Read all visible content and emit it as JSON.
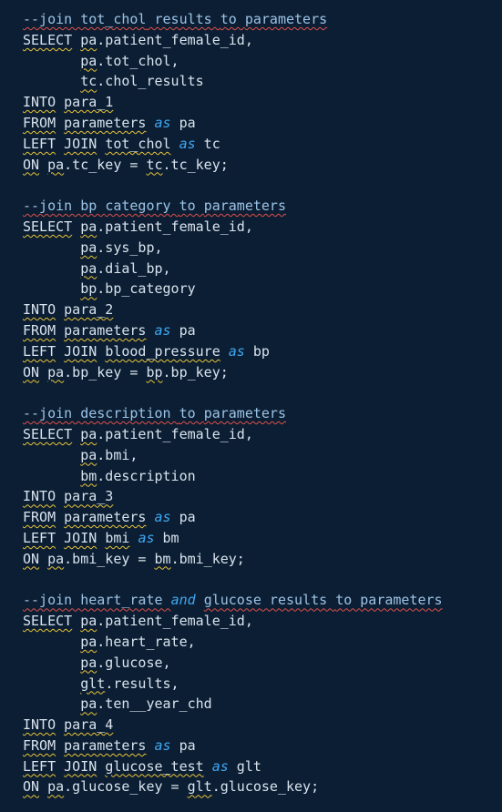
{
  "editor": {
    "lines": [
      [
        {
          "t": "--join ",
          "c": "comment sqr"
        },
        {
          "t": "tot_chol",
          "c": "comment sqr"
        },
        {
          "t": " results ",
          "c": "comment sqr"
        },
        {
          "t": "to ",
          "c": "comment sqr"
        },
        {
          "t": "parameters",
          "c": "comment sqr"
        }
      ],
      [
        {
          "t": "SELECT",
          "c": "kw sq"
        },
        {
          "t": " ",
          "c": "plain"
        },
        {
          "t": "pa",
          "c": "plain sq"
        },
        {
          "t": ".patient_female_id,",
          "c": "plain"
        }
      ],
      [
        {
          "t": "       ",
          "c": "plain"
        },
        {
          "t": "pa",
          "c": "plain sq"
        },
        {
          "t": ".tot_chol,",
          "c": "plain"
        }
      ],
      [
        {
          "t": "       ",
          "c": "plain"
        },
        {
          "t": "tc",
          "c": "plain sq"
        },
        {
          "t": ".chol_results",
          "c": "plain"
        }
      ],
      [
        {
          "t": "INTO",
          "c": "kw sq"
        },
        {
          "t": " ",
          "c": "plain"
        },
        {
          "t": "para_1",
          "c": "plain sq"
        }
      ],
      [
        {
          "t": "FROM",
          "c": "kw sq"
        },
        {
          "t": " ",
          "c": "plain"
        },
        {
          "t": "parameters",
          "c": "plain sq"
        },
        {
          "t": " ",
          "c": "plain"
        },
        {
          "t": "as",
          "c": "it"
        },
        {
          "t": " pa",
          "c": "plain"
        }
      ],
      [
        {
          "t": "LEFT",
          "c": "kw sq"
        },
        {
          "t": " ",
          "c": "plain"
        },
        {
          "t": "JOIN",
          "c": "kw sq"
        },
        {
          "t": " ",
          "c": "plain"
        },
        {
          "t": "tot_chol",
          "c": "plain sq"
        },
        {
          "t": " ",
          "c": "plain"
        },
        {
          "t": "as",
          "c": "it"
        },
        {
          "t": " tc",
          "c": "plain"
        }
      ],
      [
        {
          "t": "ON",
          "c": "kw sq"
        },
        {
          "t": " ",
          "c": "plain"
        },
        {
          "t": "pa",
          "c": "plain sq"
        },
        {
          "t": ".tc_key = ",
          "c": "plain"
        },
        {
          "t": "tc",
          "c": "plain sq"
        },
        {
          "t": ".tc_key;",
          "c": "plain"
        }
      ],
      [],
      [
        {
          "t": "--join ",
          "c": "comment sqr"
        },
        {
          "t": "bp ",
          "c": "comment sqr"
        },
        {
          "t": "category ",
          "c": "comment sqr"
        },
        {
          "t": "to ",
          "c": "comment sqr"
        },
        {
          "t": "parameters",
          "c": "comment sqr"
        }
      ],
      [
        {
          "t": "SELECT",
          "c": "kw sq"
        },
        {
          "t": " ",
          "c": "plain"
        },
        {
          "t": "pa",
          "c": "plain sq"
        },
        {
          "t": ".patient_female_id,",
          "c": "plain"
        }
      ],
      [
        {
          "t": "       ",
          "c": "plain"
        },
        {
          "t": "pa",
          "c": "plain sq"
        },
        {
          "t": ".sys_bp,",
          "c": "plain"
        }
      ],
      [
        {
          "t": "       ",
          "c": "plain"
        },
        {
          "t": "pa",
          "c": "plain sq"
        },
        {
          "t": ".dial_bp,",
          "c": "plain"
        }
      ],
      [
        {
          "t": "       ",
          "c": "plain"
        },
        {
          "t": "bp",
          "c": "plain sq"
        },
        {
          "t": ".bp_category",
          "c": "plain"
        }
      ],
      [
        {
          "t": "INTO",
          "c": "kw sq"
        },
        {
          "t": " ",
          "c": "plain"
        },
        {
          "t": "para_2",
          "c": "plain sq"
        }
      ],
      [
        {
          "t": "FROM",
          "c": "kw sq"
        },
        {
          "t": " ",
          "c": "plain"
        },
        {
          "t": "parameters",
          "c": "plain sq"
        },
        {
          "t": " ",
          "c": "plain"
        },
        {
          "t": "as",
          "c": "it"
        },
        {
          "t": " pa",
          "c": "plain"
        }
      ],
      [
        {
          "t": "LEFT",
          "c": "kw sq"
        },
        {
          "t": " ",
          "c": "plain"
        },
        {
          "t": "JOIN",
          "c": "kw sq"
        },
        {
          "t": " ",
          "c": "plain"
        },
        {
          "t": "blood_pressure",
          "c": "plain sq"
        },
        {
          "t": " ",
          "c": "plain"
        },
        {
          "t": "as",
          "c": "it"
        },
        {
          "t": " bp",
          "c": "plain"
        }
      ],
      [
        {
          "t": "ON",
          "c": "kw sq"
        },
        {
          "t": " ",
          "c": "plain"
        },
        {
          "t": "pa",
          "c": "plain sq"
        },
        {
          "t": ".bp_key = ",
          "c": "plain"
        },
        {
          "t": "bp",
          "c": "plain sq"
        },
        {
          "t": ".bp_key;",
          "c": "plain"
        }
      ],
      [],
      [
        {
          "t": "--join ",
          "c": "comment sqr"
        },
        {
          "t": "description ",
          "c": "comment sqr"
        },
        {
          "t": "to ",
          "c": "comment sqr"
        },
        {
          "t": "parameters",
          "c": "comment sqr"
        }
      ],
      [
        {
          "t": "SELECT",
          "c": "kw sq"
        },
        {
          "t": " ",
          "c": "plain"
        },
        {
          "t": "pa",
          "c": "plain sq"
        },
        {
          "t": ".patient_female_id,",
          "c": "plain"
        }
      ],
      [
        {
          "t": "       ",
          "c": "plain"
        },
        {
          "t": "pa",
          "c": "plain sq"
        },
        {
          "t": ".bmi,",
          "c": "plain"
        }
      ],
      [
        {
          "t": "       ",
          "c": "plain"
        },
        {
          "t": "bm",
          "c": "plain sq"
        },
        {
          "t": ".description",
          "c": "plain"
        }
      ],
      [
        {
          "t": "INTO",
          "c": "kw sq"
        },
        {
          "t": " ",
          "c": "plain"
        },
        {
          "t": "para_3",
          "c": "plain sq"
        }
      ],
      [
        {
          "t": "FROM",
          "c": "kw sq"
        },
        {
          "t": " ",
          "c": "plain"
        },
        {
          "t": "parameters",
          "c": "plain sq"
        },
        {
          "t": " ",
          "c": "plain"
        },
        {
          "t": "as",
          "c": "it"
        },
        {
          "t": " pa",
          "c": "plain"
        }
      ],
      [
        {
          "t": "LEFT",
          "c": "kw sq"
        },
        {
          "t": " ",
          "c": "plain"
        },
        {
          "t": "JOIN",
          "c": "kw sq"
        },
        {
          "t": " ",
          "c": "plain"
        },
        {
          "t": "bmi",
          "c": "plain sq"
        },
        {
          "t": " ",
          "c": "plain"
        },
        {
          "t": "as",
          "c": "it"
        },
        {
          "t": " bm",
          "c": "plain"
        }
      ],
      [
        {
          "t": "ON",
          "c": "kw sq"
        },
        {
          "t": " ",
          "c": "plain"
        },
        {
          "t": "pa",
          "c": "plain sq"
        },
        {
          "t": ".bmi_key = ",
          "c": "plain"
        },
        {
          "t": "bm",
          "c": "plain sq"
        },
        {
          "t": ".bmi_key;",
          "c": "plain"
        }
      ],
      [],
      [
        {
          "t": "--join ",
          "c": "comment sqr"
        },
        {
          "t": "heart_rate ",
          "c": "comment sqr"
        },
        {
          "t": "and",
          "c": "it"
        },
        {
          "t": " ",
          "c": "comment"
        },
        {
          "t": "glucose",
          "c": "comment sqr"
        },
        {
          "t": " results ",
          "c": "comment sqr"
        },
        {
          "t": "to ",
          "c": "comment sqr"
        },
        {
          "t": "parameters",
          "c": "comment sqr"
        }
      ],
      [
        {
          "t": "SELECT",
          "c": "kw sq"
        },
        {
          "t": " ",
          "c": "plain"
        },
        {
          "t": "pa",
          "c": "plain sq"
        },
        {
          "t": ".patient_female_id,",
          "c": "plain"
        }
      ],
      [
        {
          "t": "       ",
          "c": "plain"
        },
        {
          "t": "pa",
          "c": "plain sq"
        },
        {
          "t": ".heart_rate,",
          "c": "plain"
        }
      ],
      [
        {
          "t": "       ",
          "c": "plain"
        },
        {
          "t": "pa",
          "c": "plain sq"
        },
        {
          "t": ".glucose,",
          "c": "plain"
        }
      ],
      [
        {
          "t": "       ",
          "c": "plain"
        },
        {
          "t": "glt",
          "c": "plain sq"
        },
        {
          "t": ".results,",
          "c": "plain"
        }
      ],
      [
        {
          "t": "       ",
          "c": "plain"
        },
        {
          "t": "pa",
          "c": "plain sq"
        },
        {
          "t": ".ten__year_chd",
          "c": "plain"
        }
      ],
      [
        {
          "t": "INTO",
          "c": "kw sq"
        },
        {
          "t": " ",
          "c": "plain"
        },
        {
          "t": "para_4",
          "c": "plain sq"
        }
      ],
      [
        {
          "t": "FROM",
          "c": "kw sq"
        },
        {
          "t": " ",
          "c": "plain"
        },
        {
          "t": "parameters",
          "c": "plain sq"
        },
        {
          "t": " ",
          "c": "plain"
        },
        {
          "t": "as",
          "c": "it"
        },
        {
          "t": " pa",
          "c": "plain"
        }
      ],
      [
        {
          "t": "LEFT",
          "c": "kw sq"
        },
        {
          "t": " ",
          "c": "plain"
        },
        {
          "t": "JOIN",
          "c": "kw sq"
        },
        {
          "t": " ",
          "c": "plain"
        },
        {
          "t": "glucose_test",
          "c": "plain sq"
        },
        {
          "t": " ",
          "c": "plain"
        },
        {
          "t": "as",
          "c": "it"
        },
        {
          "t": " glt",
          "c": "plain"
        }
      ],
      [
        {
          "t": "ON",
          "c": "kw sq"
        },
        {
          "t": " ",
          "c": "plain"
        },
        {
          "t": "pa",
          "c": "plain sq"
        },
        {
          "t": ".glucose_key = ",
          "c": "plain"
        },
        {
          "t": "glt",
          "c": "plain sq"
        },
        {
          "t": ".glucose_key;",
          "c": "plain"
        }
      ]
    ]
  }
}
